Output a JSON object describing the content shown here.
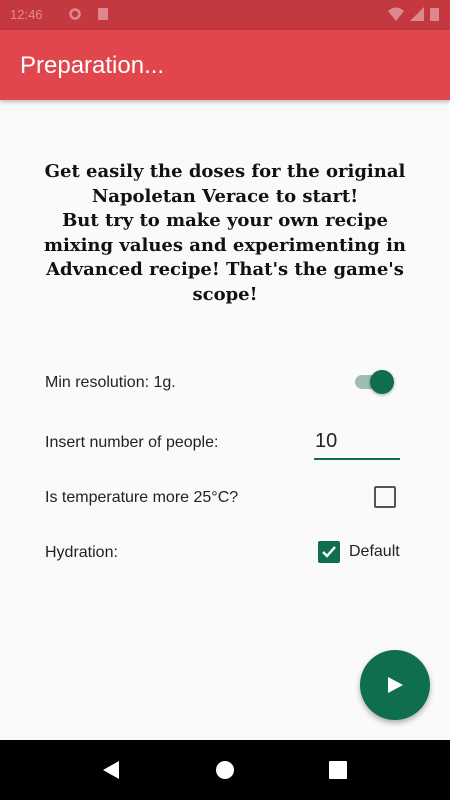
{
  "status_bar": {
    "time": "12:46",
    "icons": [
      "settings-icon",
      "storage-icon",
      "wifi-icon",
      "battery-icon"
    ]
  },
  "app_bar": {
    "title": "Preparation..."
  },
  "intro_text": "Get easily the doses for the original Napoletan Verace to start!\n      But try to make your own recipe mixing values and experimenting in Advanced recipe! That's the game's scope!",
  "settings": {
    "min_resolution": {
      "label": "Min resolution: 1g.",
      "enabled": true
    },
    "people": {
      "label": "Insert number of people:",
      "value": "10"
    },
    "temperature": {
      "label": "Is temperature more 25°C?",
      "checked": false
    },
    "hydration": {
      "label": "Hydration:",
      "checkbox_label": "Default",
      "checked": true
    }
  },
  "fab": {
    "icon": "play-icon"
  },
  "nav_bar": {
    "icons": [
      "back-icon",
      "home-icon",
      "recents-icon"
    ]
  },
  "colors": {
    "app_bar": "#e0464c",
    "status_bar": "#c3393f",
    "accent": "#0f6e50",
    "background": "#fafafa"
  }
}
